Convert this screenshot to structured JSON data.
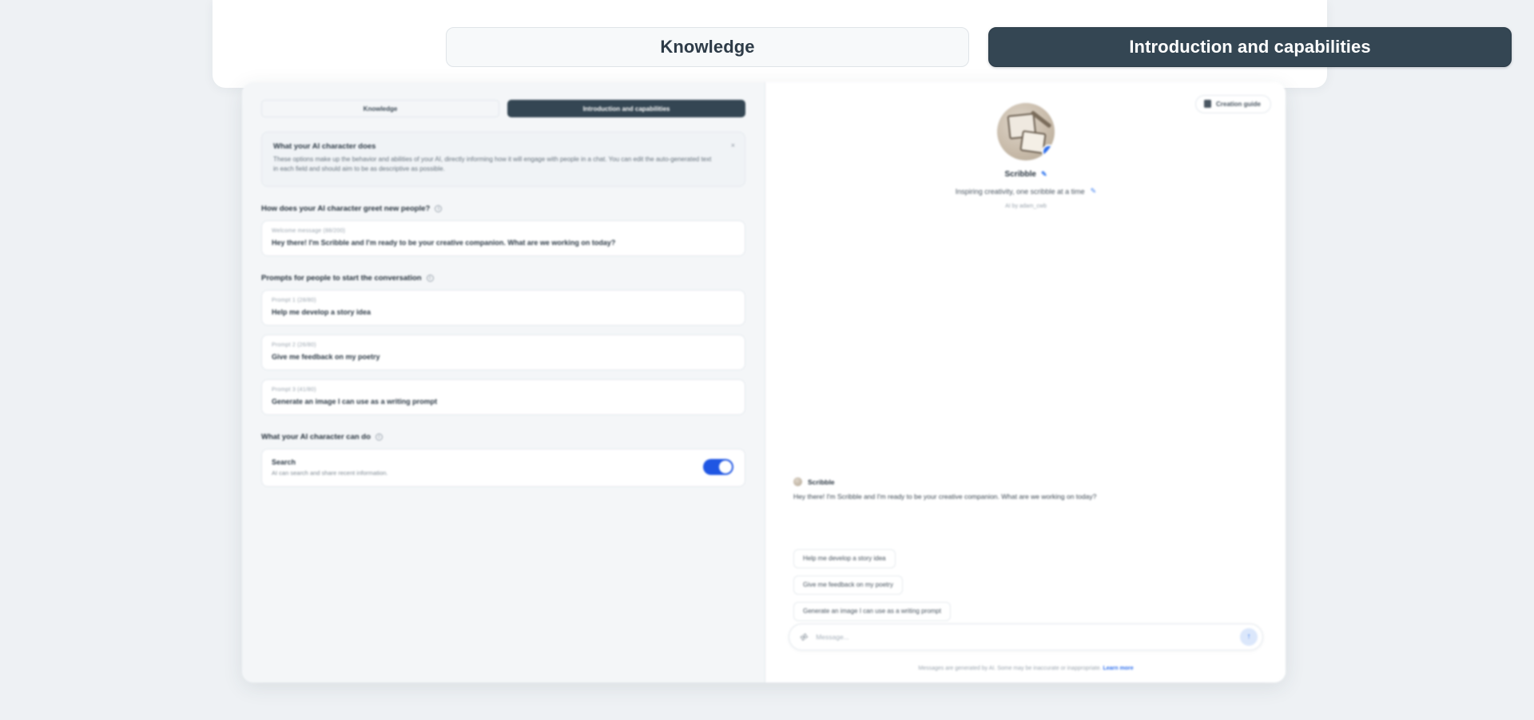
{
  "tabs": [
    {
      "label": "Knowledge",
      "active": false
    },
    {
      "label": "Introduction and capabilities",
      "active": true
    }
  ],
  "colors": {
    "active_tab_bg": "#344653",
    "toggle_on": "#1f56e3",
    "accent_link": "#2f6fed",
    "page_bg": "#eef1f4"
  },
  "info_banner": {
    "title": "What your AI character does",
    "body": "These options make up the behavior and abilities of your AI, directly informing how it will engage with people in a chat. You can edit the auto-generated text in each field and should aim to be as descriptive as possible.",
    "close_label": "×"
  },
  "sections": {
    "greeting": {
      "heading": "How does your AI character greet new people?",
      "field_label": "Welcome message (88/200)",
      "field_value": "Hey there! I'm Scribble and I'm ready to be your creative companion. What are we working on today?"
    },
    "prompts": {
      "heading": "Prompts for people to start the conversation",
      "items": [
        {
          "label": "Prompt 1 (28/80)",
          "value": "Help me develop a story idea"
        },
        {
          "label": "Prompt 2 (26/80)",
          "value": "Give me feedback on my poetry"
        },
        {
          "label": "Prompt 3 (41/80)",
          "value": "Generate an image I can use as a writing prompt"
        }
      ]
    },
    "capabilities": {
      "heading": "What your AI character can do",
      "items": [
        {
          "name": "Search",
          "description": "AI can search and share recent information.",
          "enabled": true
        }
      ]
    }
  },
  "preview": {
    "guide_button": "Creation guide",
    "character_name": "Scribble",
    "tagline": "Inspiring creativity, one scribble at a time",
    "meta": "AI by adam_cwb",
    "verified_badge": "✓",
    "edit_icon": "✎",
    "message": {
      "author": "Scribble",
      "text": "Hey there! I'm Scribble and I'm ready to be your creative companion. What are we working on today?"
    },
    "suggestion_chips": [
      "Help me develop a story idea",
      "Give me feedback on my poetry",
      "Generate an image I can use as a writing prompt"
    ],
    "composer": {
      "placeholder": "Message...",
      "attach_icon": "✉",
      "send_icon": "↑"
    },
    "disclaimer": "Messages are generated by AI. Some may be inaccurate or inappropriate.",
    "disclaimer_link": "Learn more"
  }
}
